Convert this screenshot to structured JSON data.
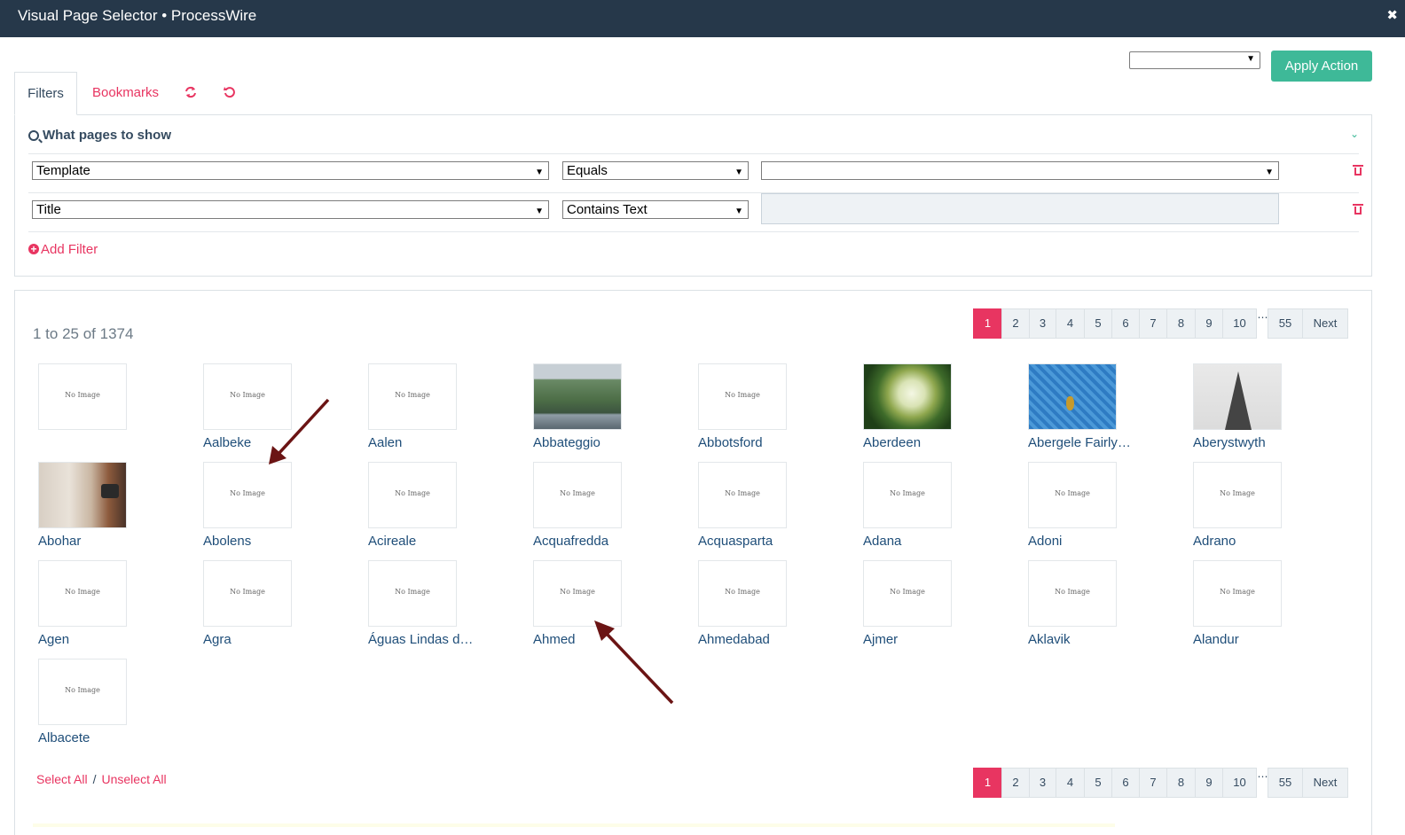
{
  "window": {
    "title": "Visual Page Selector • ProcessWire",
    "close_glyph": "✖"
  },
  "actions": {
    "select_value": "",
    "apply_label": "Apply Action"
  },
  "tabs": {
    "filters": "Filters",
    "bookmarks": "Bookmarks",
    "refresh_icon": "refresh-icon",
    "reset_icon": "reset-icon"
  },
  "filter_panel": {
    "heading": "What pages to show",
    "rows": [
      {
        "field": "Template",
        "operator": "Equals",
        "value": ""
      },
      {
        "field": "Title",
        "operator": "Contains Text",
        "value": ""
      }
    ],
    "add_filter": "Add Filter"
  },
  "results": {
    "count_text": "1 to 25 of 1374",
    "pagination": {
      "pages": [
        "1",
        "2",
        "3",
        "4",
        "5",
        "6",
        "7",
        "8",
        "9",
        "10"
      ],
      "last": "55",
      "next": "Next",
      "active": "1"
    },
    "no_image_text": "No Image",
    "items": [
      {
        "label": "",
        "image": "none"
      },
      {
        "label": "Aalbeke",
        "image": "none"
      },
      {
        "label": "Aalen",
        "image": "none"
      },
      {
        "label": "Abbateggio",
        "image": "park"
      },
      {
        "label": "Abbotsford",
        "image": "none"
      },
      {
        "label": "Aberdeen",
        "image": "flower"
      },
      {
        "label": "Abergele Fairly…",
        "image": "pool"
      },
      {
        "label": "Aberystwyth",
        "image": "building"
      },
      {
        "label": "Abohar",
        "image": "desk"
      },
      {
        "label": "Abolens",
        "image": "none"
      },
      {
        "label": "Acireale",
        "image": "none"
      },
      {
        "label": "Acquafredda",
        "image": "none"
      },
      {
        "label": "Acquasparta",
        "image": "none"
      },
      {
        "label": "Adana",
        "image": "none"
      },
      {
        "label": "Adoni",
        "image": "none"
      },
      {
        "label": "Adrano",
        "image": "none"
      },
      {
        "label": "Agen",
        "image": "none"
      },
      {
        "label": "Agra",
        "image": "none"
      },
      {
        "label": "Águas Lindas de…",
        "image": "none"
      },
      {
        "label": "Ahmed",
        "image": "none"
      },
      {
        "label": "Ahmedabad",
        "image": "none"
      },
      {
        "label": "Ajmer",
        "image": "none"
      },
      {
        "label": "Aklavik",
        "image": "none"
      },
      {
        "label": "Alandur",
        "image": "none"
      },
      {
        "label": "Albacete",
        "image": "none"
      }
    ],
    "select_all": "Select All",
    "separator": "/",
    "unselect_all": "Unselect All"
  },
  "colors": {
    "accent": "#e83561",
    "primary_button": "#3eb998",
    "titlebar": "#26384a",
    "annotation_arrow": "#6b1414"
  }
}
